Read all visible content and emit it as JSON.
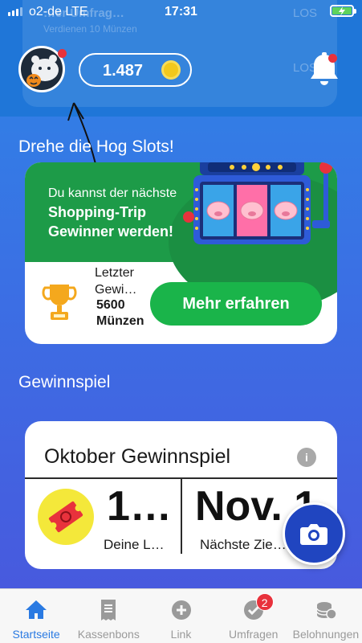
{
  "status_bar": {
    "carrier": "o2-de",
    "network": "LTE",
    "time": "17:31"
  },
  "header": {
    "ghost_title": "…er Umfrag…",
    "ghost_subtitle": "Verdienen 10 Münzen",
    "ghost_action_1": "LOS",
    "ghost_action_2": "LOS",
    "coin_balance": "1.487",
    "avatar_icon": "halloween-avatar-icon",
    "coin_icon": "coin-icon",
    "notification_icon": "bell-icon"
  },
  "hog_slots": {
    "section_title": "Drehe die Hog Slots!",
    "promo_line_1": "Du kannst der nächste",
    "promo_line_2": "Shopping-Trip",
    "promo_line_3": "Gewinner werden!",
    "last_winner_label": "Letzter Gewi…",
    "last_winner_value": "5600 Münzen",
    "more_button": "Mehr erfahren"
  },
  "sweepstakes": {
    "section_title": "Gewinnspiel",
    "card_title": "Oktober Gewinnspiel",
    "info_label": "i",
    "tickets_value": "1…",
    "tickets_label": "Deine L…",
    "next_draw_value": "Nov. 1",
    "next_draw_label": "Nächste Zie…"
  },
  "tabs": [
    {
      "label": "Startseite",
      "icon": "home-icon",
      "active": true
    },
    {
      "label": "Kassenbons",
      "icon": "receipt-icon",
      "active": false
    },
    {
      "label": "Link",
      "icon": "plus-circle-icon",
      "active": false
    },
    {
      "label": "Umfragen",
      "icon": "check-circle-icon",
      "active": false,
      "badge": "2"
    },
    {
      "label": "Belohnungen",
      "icon": "coins-icon",
      "active": false
    }
  ],
  "colors": {
    "accent": "#2a7ae2",
    "green": "#1ab44a",
    "badge": "#e8323c"
  }
}
